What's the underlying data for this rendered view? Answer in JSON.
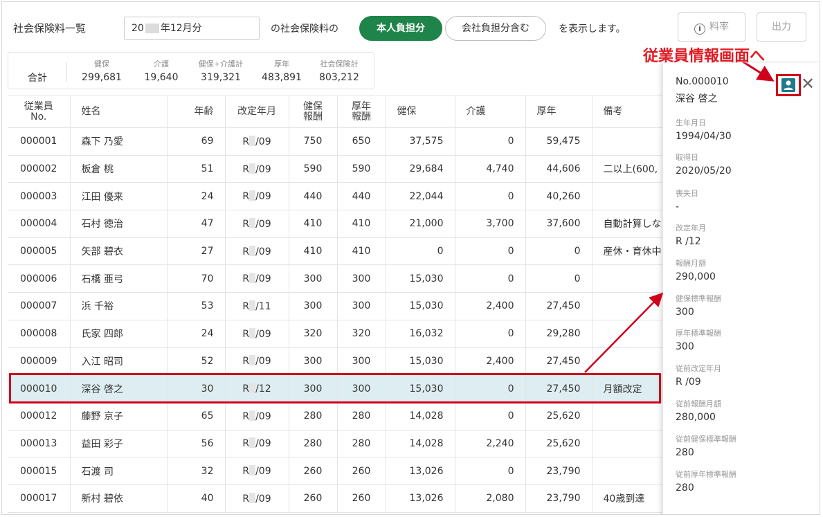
{
  "header": {
    "title": "社会保険料一覧",
    "period_prefix": "20",
    "period_suffix": "年12月分",
    "of_label": "の社会保険料の",
    "own_share_label": "本人負担分",
    "company_share_label": "会社負担分含む",
    "show_label": "を表示します。",
    "rate_label": "料率",
    "output_label": "出力"
  },
  "totals": {
    "label": "合計",
    "items": [
      {
        "label": "健保",
        "value": "299,681"
      },
      {
        "label": "介護",
        "value": "19,640"
      },
      {
        "label": "健保+介護計",
        "value": "319,321"
      },
      {
        "label": "厚年",
        "value": "483,891"
      },
      {
        "label": "社会保険計",
        "value": "803,212"
      }
    ]
  },
  "table": {
    "headers": {
      "no_line1": "従業員",
      "no_line2": "No.",
      "name": "姓名",
      "age": "年齢",
      "revision": "改定年月",
      "kenpo_line1": "健保",
      "kenpo_line2": "報酬",
      "kounen_line1": "厚年",
      "kounen_line2": "報酬",
      "kenpo": "健保",
      "kaigo": "介護",
      "kounen": "厚年",
      "note": "備考"
    },
    "rows": [
      {
        "no": "000001",
        "name": "森下 乃愛",
        "age": "69",
        "rev_r": "R",
        "rev_m": "/09",
        "kenpo_pay": "750",
        "kounen_pay": "650",
        "kenpo": "37,575",
        "kaigo": "0",
        "kounen": "59,475",
        "note": ""
      },
      {
        "no": "000002",
        "name": "板倉 桃",
        "age": "51",
        "rev_r": "R",
        "rev_m": "/09",
        "kenpo_pay": "590",
        "kounen_pay": "590",
        "kenpo": "29,684",
        "kaigo": "4,740",
        "kounen": "44,606",
        "note": "二以上(600,"
      },
      {
        "no": "000003",
        "name": "江田 優来",
        "age": "24",
        "rev_r": "R",
        "rev_m": "/09",
        "kenpo_pay": "440",
        "kounen_pay": "440",
        "kenpo": "22,044",
        "kaigo": "0",
        "kounen": "40,260",
        "note": ""
      },
      {
        "no": "000004",
        "name": "石村 徳治",
        "age": "47",
        "rev_r": "R",
        "rev_m": "/09",
        "kenpo_pay": "410",
        "kounen_pay": "410",
        "kenpo": "21,000",
        "kaigo": "3,700",
        "kounen": "37,600",
        "note": "自動計算しな"
      },
      {
        "no": "000005",
        "name": "矢部 碧衣",
        "age": "27",
        "rev_r": "R",
        "rev_m": "/09",
        "kenpo_pay": "410",
        "kounen_pay": "410",
        "kenpo": "0",
        "kaigo": "0",
        "kounen": "0",
        "note": "産休・育休中"
      },
      {
        "no": "000006",
        "name": "石橋 亜弓",
        "age": "70",
        "rev_r": "R",
        "rev_m": "/09",
        "kenpo_pay": "300",
        "kounen_pay": "300",
        "kenpo": "15,030",
        "kaigo": "0",
        "kounen": "0",
        "note": ""
      },
      {
        "no": "000007",
        "name": "浜 千裕",
        "age": "53",
        "rev_r": "R",
        "rev_m": "/11",
        "kenpo_pay": "300",
        "kounen_pay": "300",
        "kenpo": "15,030",
        "kaigo": "2,400",
        "kounen": "27,450",
        "note": ""
      },
      {
        "no": "000008",
        "name": "氏家 四郎",
        "age": "24",
        "rev_r": "R",
        "rev_m": "/09",
        "kenpo_pay": "320",
        "kounen_pay": "320",
        "kenpo": "16,032",
        "kaigo": "0",
        "kounen": "29,280",
        "note": ""
      },
      {
        "no": "000009",
        "name": "入江 昭司",
        "age": "52",
        "rev_r": "R",
        "rev_m": "/09",
        "kenpo_pay": "300",
        "kounen_pay": "300",
        "kenpo": "15,030",
        "kaigo": "2,400",
        "kounen": "27,450",
        "note": ""
      },
      {
        "no": "000010",
        "name": "深谷 啓之",
        "age": "30",
        "rev_r": "R",
        "rev_m": "/12",
        "kenpo_pay": "300",
        "kounen_pay": "300",
        "kenpo": "15,030",
        "kaigo": "0",
        "kounen": "27,450",
        "note": "月額改定",
        "selected": true
      },
      {
        "no": "000012",
        "name": "藤野 京子",
        "age": "65",
        "rev_r": "R",
        "rev_m": "/09",
        "kenpo_pay": "280",
        "kounen_pay": "280",
        "kenpo": "14,028",
        "kaigo": "0",
        "kounen": "25,620",
        "note": ""
      },
      {
        "no": "000013",
        "name": "益田 彩子",
        "age": "56",
        "rev_r": "R",
        "rev_m": "/09",
        "kenpo_pay": "280",
        "kounen_pay": "280",
        "kenpo": "14,028",
        "kaigo": "2,240",
        "kounen": "25,620",
        "note": ""
      },
      {
        "no": "000015",
        "name": "石渡 司",
        "age": "32",
        "rev_r": "R",
        "rev_m": "/09",
        "kenpo_pay": "260",
        "kounen_pay": "260",
        "kenpo": "13,026",
        "kaigo": "0",
        "kounen": "23,790",
        "note": ""
      },
      {
        "no": "000017",
        "name": "新村 碧依",
        "age": "40",
        "rev_r": "R",
        "rev_m": "/09",
        "kenpo_pay": "260",
        "kounen_pay": "260",
        "kenpo": "13,026",
        "kaigo": "2,080",
        "kounen": "23,790",
        "note": "40歳到達"
      }
    ]
  },
  "panel": {
    "no": "No.000010",
    "name": "深谷 啓之",
    "fields": [
      {
        "label": "生年月日",
        "value": "1994/04/30"
      },
      {
        "label": "取得日",
        "value": "2020/05/20"
      },
      {
        "label": "喪失日",
        "value": "-"
      },
      {
        "label": "改定年月",
        "value": "R  /12"
      },
      {
        "label": "報酬月額",
        "value": "290,000"
      },
      {
        "label": "健保標準報酬",
        "value": "300"
      },
      {
        "label": "厚年標準報酬",
        "value": "300"
      },
      {
        "label": "従前改定年月",
        "value": "R  /09"
      },
      {
        "label": "従前報酬月額",
        "value": "280,000"
      },
      {
        "label": "従前健保標準報酬",
        "value": "280"
      },
      {
        "label": "従前厚年標準報酬",
        "value": "280"
      }
    ]
  },
  "annotation": {
    "callout": "従業員情報画面へ",
    "color": "#d0021b"
  },
  "colors": {
    "accent_green": "#1e8449",
    "selected_row": "#deedf1",
    "person_icon": "#1f7a8c"
  },
  "icons": {
    "info": "info-circle-icon",
    "person": "person-icon",
    "close": "close-icon"
  }
}
